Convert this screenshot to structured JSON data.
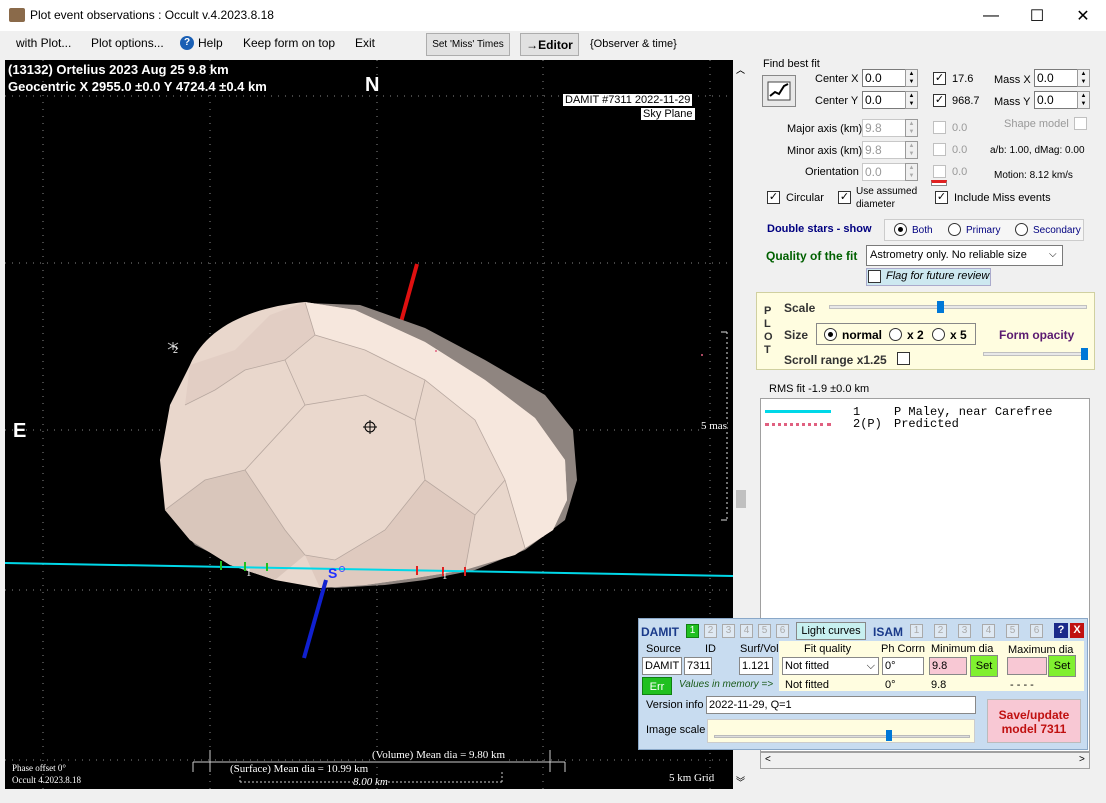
{
  "window": {
    "title": "Plot event observations : Occult v.4.2023.8.18",
    "minimize": "—",
    "maximize": "☐",
    "close": "✕"
  },
  "menu": {
    "with_plot": "with Plot...",
    "plot_options": "Plot options...",
    "help": "Help",
    "keep_on_top": "Keep form on top",
    "exit": "Exit",
    "set_miss_times": "Set 'Miss' Times",
    "editor": "→Editor",
    "observer_time": "{Observer & time}"
  },
  "plot": {
    "line1": "(13132) Ortelius  2023 Aug 25  9.8 km",
    "line2": "Geocentric  X  2955.0 ±0.0  Y 4724.4 ±0.4 km",
    "north": "N",
    "east": "E",
    "south": "S",
    "damit_label": "DAMIT #7311 2022-11-29",
    "sky_plane": "Sky Plane",
    "scale_mas": "5 mas",
    "chord1_label_a": "1",
    "chord1_label_b": "1",
    "star_label": "2",
    "phase_offset": "Phase offset 0°",
    "occult_version": "Occult 4.2023.8.18",
    "volume_dia": "(Volume) Mean dia = 9.80 km",
    "surface_dia": "(Surface) Mean dia = 10.99 km",
    "eight_km": "8.00 km",
    "grid": "5 km Grid"
  },
  "fit": {
    "find_best_fit": "Find best fit",
    "center_x_label": "Center X",
    "center_x": "0.0",
    "center_y_label": "Center Y",
    "center_y": "0.0",
    "chk_176": "17.6",
    "chk_9687": "968.7",
    "mass_x_label": "Mass X",
    "mass_x": "0.0",
    "mass_y_label": "Mass Y",
    "mass_y": "0.0",
    "major_label": "Major axis (km)",
    "major": "9.8",
    "major_chk": "0.0",
    "minor_label": "Minor axis (km)",
    "minor": "9.8",
    "minor_chk": "0.0",
    "orient_label": "Orientation",
    "orient": "0.0",
    "orient_chk": "0.0",
    "shape_model": "Shape model",
    "ab_dmag": "a/b: 1.00, dMag: 0.00",
    "motion": "Motion: 8.12 km/s",
    "circular": "Circular",
    "use_assumed": "Use assumed",
    "diameter": "diameter",
    "include_miss": "Include Miss events",
    "double_stars": "Double stars - show",
    "both": "Both",
    "primary": "Primary",
    "secondary": "Secondary",
    "quality_label": "Quality of the fit",
    "quality_value": "Astrometry only. No reliable size",
    "flag_review": "Flag for future review"
  },
  "plotbox": {
    "p": "P",
    "l": "L",
    "o": "O",
    "t": "T",
    "scale": "Scale",
    "size": "Size",
    "normal": "normal",
    "x2": "x 2",
    "x5": "x 5",
    "form_opacity": "Form opacity",
    "scroll_range": "Scroll range x1.25",
    "scale_level": 0.43,
    "opacity_level": 0.97
  },
  "rms": "RMS fit -1.9 ±0.0 km",
  "legend": {
    "row1_num": "1",
    "row1_text": "P Maley, near Carefree",
    "row2_num": "2(P)",
    "row2_text": "Predicted"
  },
  "damit": {
    "damit": "DAMIT",
    "tabs_a": [
      "1",
      "2",
      "3",
      "4",
      "5",
      "6"
    ],
    "light_curves": "Light curves",
    "isam": "ISAM",
    "tabs_b": [
      "1",
      "2",
      "3",
      "4",
      "5",
      "6"
    ],
    "help": "?",
    "close": "X",
    "source_label": "Source",
    "id_label": "ID",
    "surfvol_label": "Surf/Vol",
    "fit_quality_label": "Fit quality",
    "ph_corr_label": "Ph Corrn",
    "min_dia_label": "Minimum dia",
    "max_dia_label": "Maximum dia",
    "source": "DAMIT",
    "id": "7311",
    "surfvol": "1.121",
    "fit_quality": "Not fitted",
    "ph_corr": "0°",
    "min_dia": "9.8",
    "set": "Set",
    "set2": "Set",
    "err": "Err",
    "mem_label": "Values in memory =>",
    "mem_fit": "Not fitted",
    "mem_ph": "0°",
    "mem_min": "9.8",
    "mem_max": "- - - -",
    "version_label": "Version info",
    "version": "2022-11-29, Q=1",
    "image_scale": "Image scale",
    "save_line1": "Save/update",
    "save_line2": "model 7311"
  },
  "colors": {
    "cyan": "#00d8e8",
    "red_pole": "#e01010",
    "blue_pole": "#1020d0",
    "asteroid": "#e9d7cc"
  }
}
